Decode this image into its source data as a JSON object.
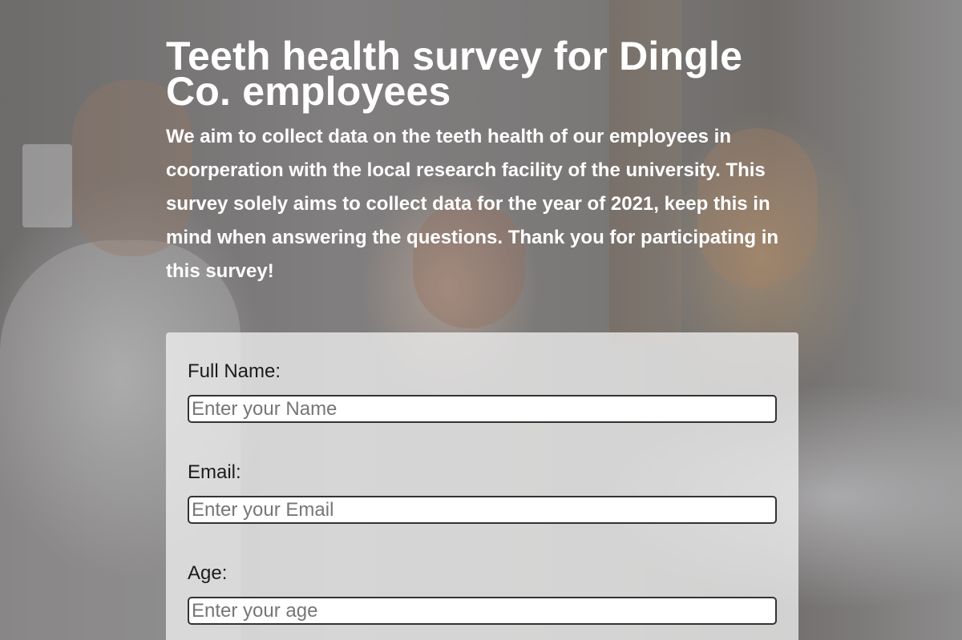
{
  "header": {
    "title": "Teeth health survey for Dingle Co. employees",
    "description": "We aim to collect data on the teeth health of our employees in coorperation with the local research facility of the university. This survey solely aims to collect data for the year of 2021, keep this in mind when answering the questions. Thank you for participating in this survey!"
  },
  "form": {
    "fields": [
      {
        "label": "Full Name:",
        "placeholder": "Enter your Name",
        "value": ""
      },
      {
        "label": "Email:",
        "placeholder": "Enter your Email",
        "value": ""
      },
      {
        "label": "Age:",
        "placeholder": "Enter your age",
        "value": ""
      }
    ]
  },
  "colors": {
    "title_text": "#ffffff",
    "form_background": "#eeeeee",
    "input_border": "#333333",
    "placeholder": "#767676"
  },
  "background": {
    "icon": "dental-office-photo"
  }
}
